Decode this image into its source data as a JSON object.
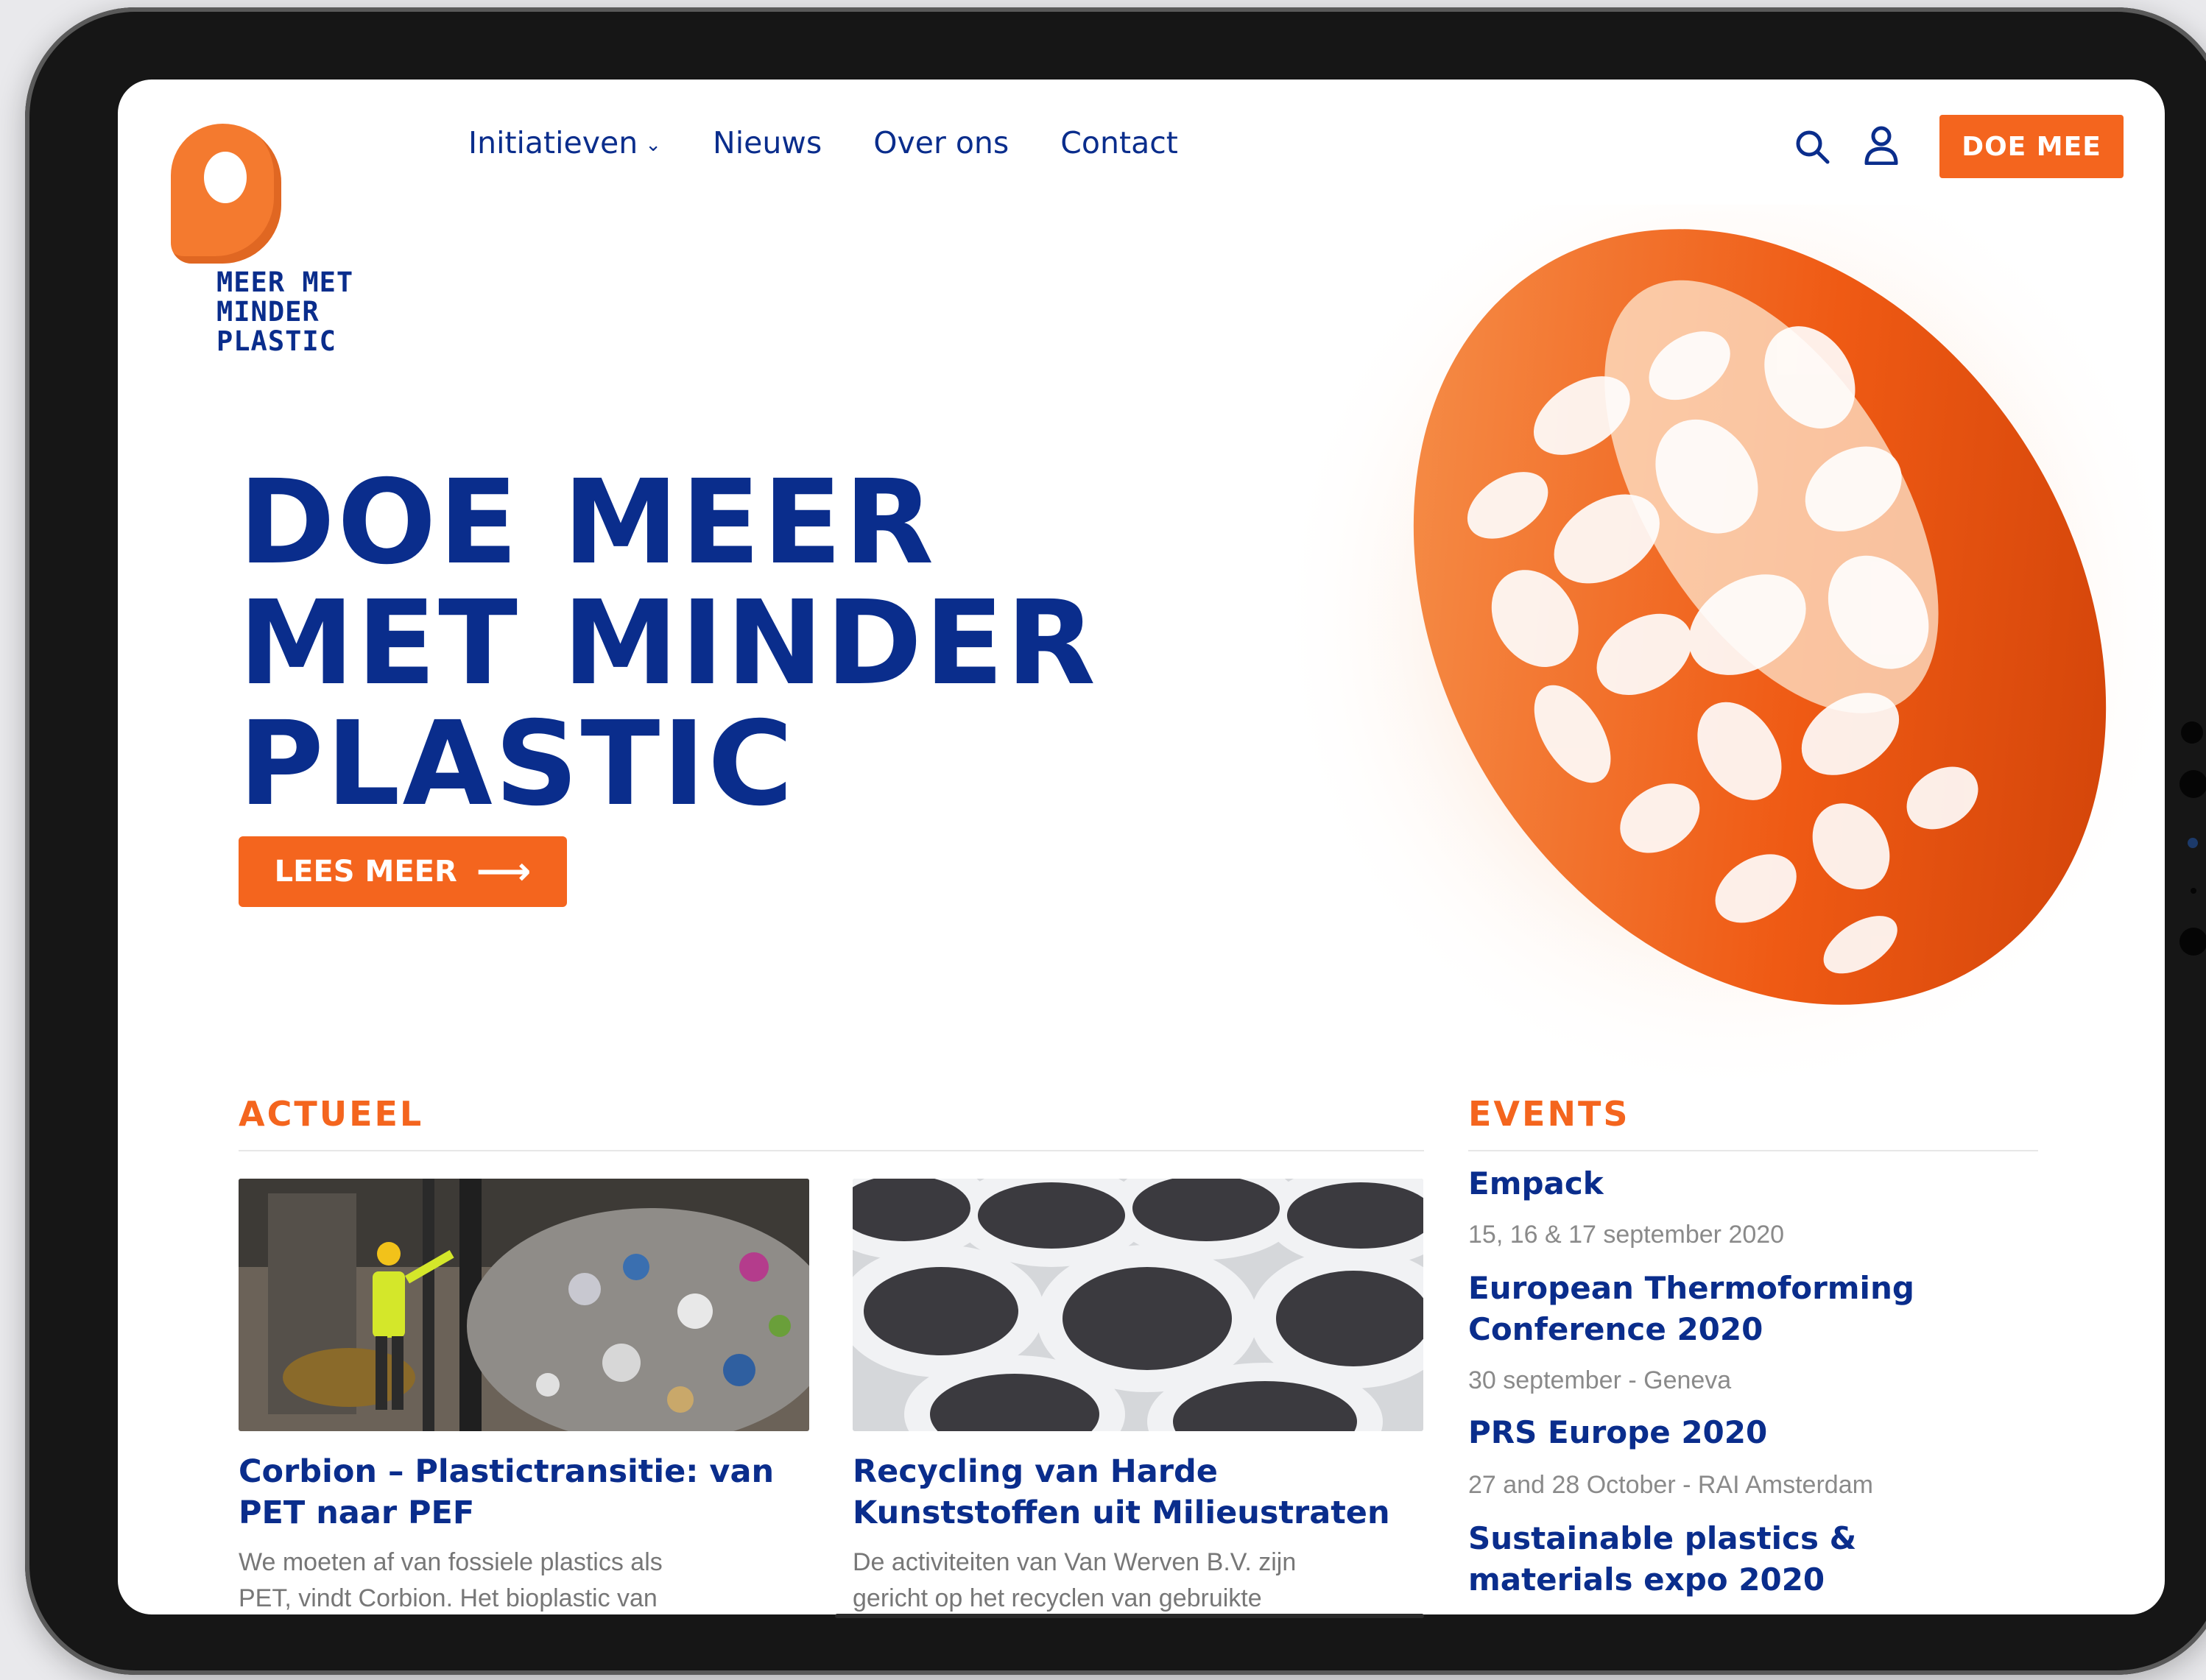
{
  "brand": {
    "logo_lines": [
      "MEER MET",
      "MINDER",
      "PLASTIC"
    ],
    "colors": {
      "primary_blue": "#0a2d8c",
      "accent_orange": "#f4651e"
    }
  },
  "nav": {
    "items": [
      {
        "label": "Initiatieven",
        "has_dropdown": true
      },
      {
        "label": "Nieuws"
      },
      {
        "label": "Over ons"
      },
      {
        "label": "Contact"
      }
    ],
    "icons": [
      "search-icon",
      "user-icon"
    ],
    "cta_label": "DOE MEE"
  },
  "hero": {
    "title_lines": [
      "DOE MEER",
      "MET MINDER",
      "PLASTIC"
    ],
    "button_label": "LEES MEER",
    "button_icon": "arrow-right-icon"
  },
  "actueel": {
    "heading": "ACTUEEL",
    "articles": [
      {
        "title_lines": [
          "Corbion – Plastictransitie: van",
          "PET naar PEF"
        ],
        "excerpt_lines": [
          "We moeten af van fossiele plastics als",
          "PET, vindt Corbion. Het bioplastic van"
        ]
      },
      {
        "title_lines": [
          "Recycling van Harde",
          "Kunststoffen uit Milieustraten"
        ],
        "excerpt_lines": [
          "De activiteiten van Van Werven B.V. zijn",
          "gericht op het recyclen van gebruikte"
        ]
      }
    ]
  },
  "events": {
    "heading": "EVENTS",
    "items": [
      {
        "title_lines": [
          "Empack"
        ],
        "meta": "15, 16 & 17 september 2020"
      },
      {
        "title_lines": [
          "European Thermoforming",
          "Conference 2020"
        ],
        "meta": "30 september - Geneva"
      },
      {
        "title_lines": [
          "PRS Europe 2020"
        ],
        "meta": "27 and 28 October - RAI Amsterdam"
      },
      {
        "title_lines": [
          "Sustainable plastics &",
          "materials expo 2020"
        ],
        "meta": ""
      }
    ]
  }
}
